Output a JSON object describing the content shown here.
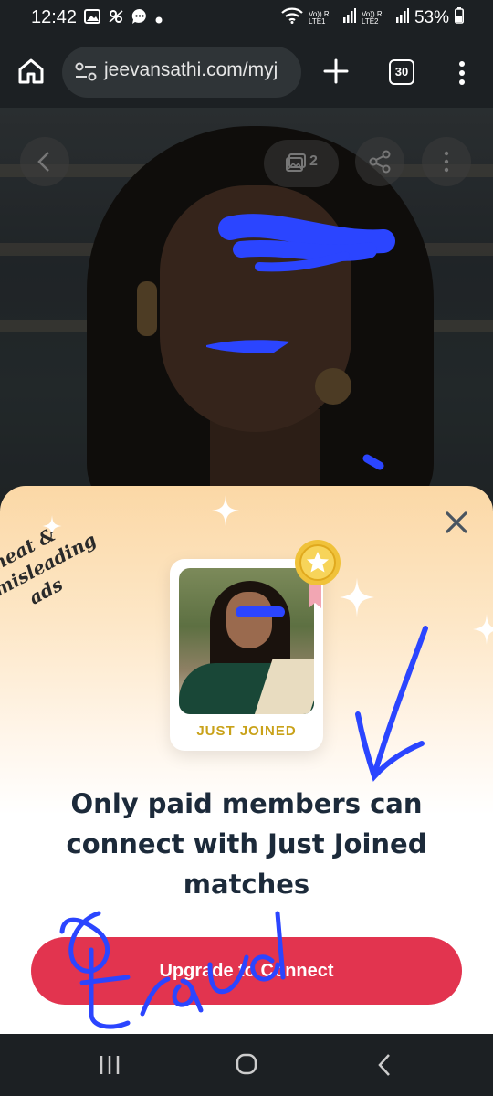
{
  "status_bar": {
    "time": "12:42",
    "sim1_label": "Vo)) R LTE1",
    "sim2_label": "Vo)) R LTE2",
    "battery": "53%",
    "icons": [
      "gallery-icon",
      "link-icon",
      "message-icon",
      "dot-icon",
      "wifi-icon",
      "signal-icon",
      "battery-icon"
    ]
  },
  "browser": {
    "url": "jeevansathi.com/myj",
    "tab_count": "30"
  },
  "profile_photo": {
    "photo_count": "2"
  },
  "sheet": {
    "badge": "JUST JOINED",
    "annotation_line1": "cheat & misleading",
    "annotation_line2": "ads",
    "headline": "Only paid members can connect with Just Joined matches",
    "cta_label": "Upgrade to Connect",
    "handwritten_word": "Fraud",
    "colors": {
      "cta": "#e2344f",
      "badge_text": "#c9a21a",
      "headline": "#1c2a3a",
      "scribble": "#2b45ff"
    }
  }
}
